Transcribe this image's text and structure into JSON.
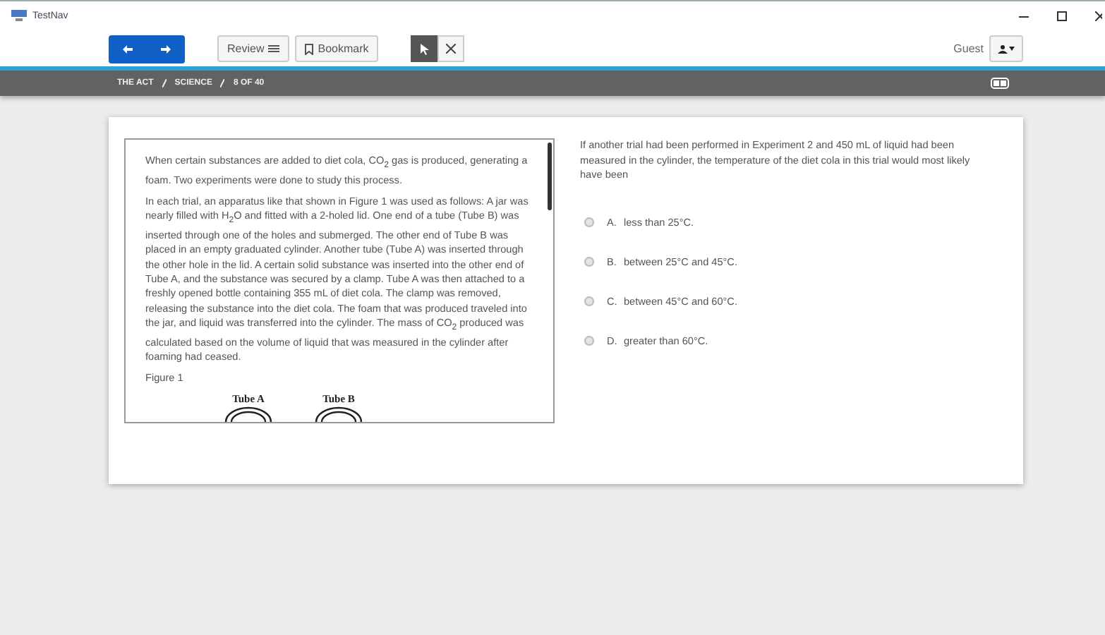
{
  "window": {
    "title": "TestNav"
  },
  "toolbar": {
    "review": "Review",
    "bookmark": "Bookmark",
    "tools": [
      {
        "kind": "pointer",
        "selected": true
      },
      {
        "kind": "eliminate",
        "selected": false
      }
    ],
    "user": "Guest"
  },
  "breadcrumb": [
    "THE ACT",
    "SCIENCE",
    "8 OF 40"
  ],
  "passage": {
    "paragraphs": [
      "When certain substances are added to diet cola, CO$_{2}$ gas is produced, generating a foam. Two experiments were done to study this process.",
      "In each trial, an apparatus like that shown in Figure 1 was used as follows: A jar was nearly filled with H$_{2}$O and fitted with a 2-holed lid. One end of a tube (Tube B) was inserted through one of the holes and submerged. The other end of Tube B was placed in an empty graduated cylinder. Another tube (Tube A) was inserted through the other hole in the lid. A certain solid substance was inserted into the other end of Tube A, and the substance was secured by a clamp. Tube A was then attached to a freshly opened bottle containing 355 mL of diet cola. The clamp was removed, releasing the substance into the diet cola. The foam that was produced traveled into the jar, and liquid was transferred into the cylinder. The mass of CO$_{2}$ produced was calculated based on the volume of liquid that was measured in the cylinder after foaming had ceased."
    ],
    "figure_caption": "Figure 1",
    "figure_labels": [
      "Tube A",
      "Tube B"
    ]
  },
  "question": {
    "stem": "If another trial had been performed in Experiment 2 and 450 mL of liquid had been measured in the cylinder, the temperature of the diet cola in this trial would most likely have been",
    "options": [
      {
        "letter": "A.",
        "text": "less than 25°C.",
        "selected": false
      },
      {
        "letter": "B.",
        "text": "between 25°C and 45°C.",
        "selected": false
      },
      {
        "letter": "C.",
        "text": "between 45°C and 60°C.",
        "selected": false
      },
      {
        "letter": "D.",
        "text": "greater than 60°C.",
        "selected": false
      }
    ]
  }
}
